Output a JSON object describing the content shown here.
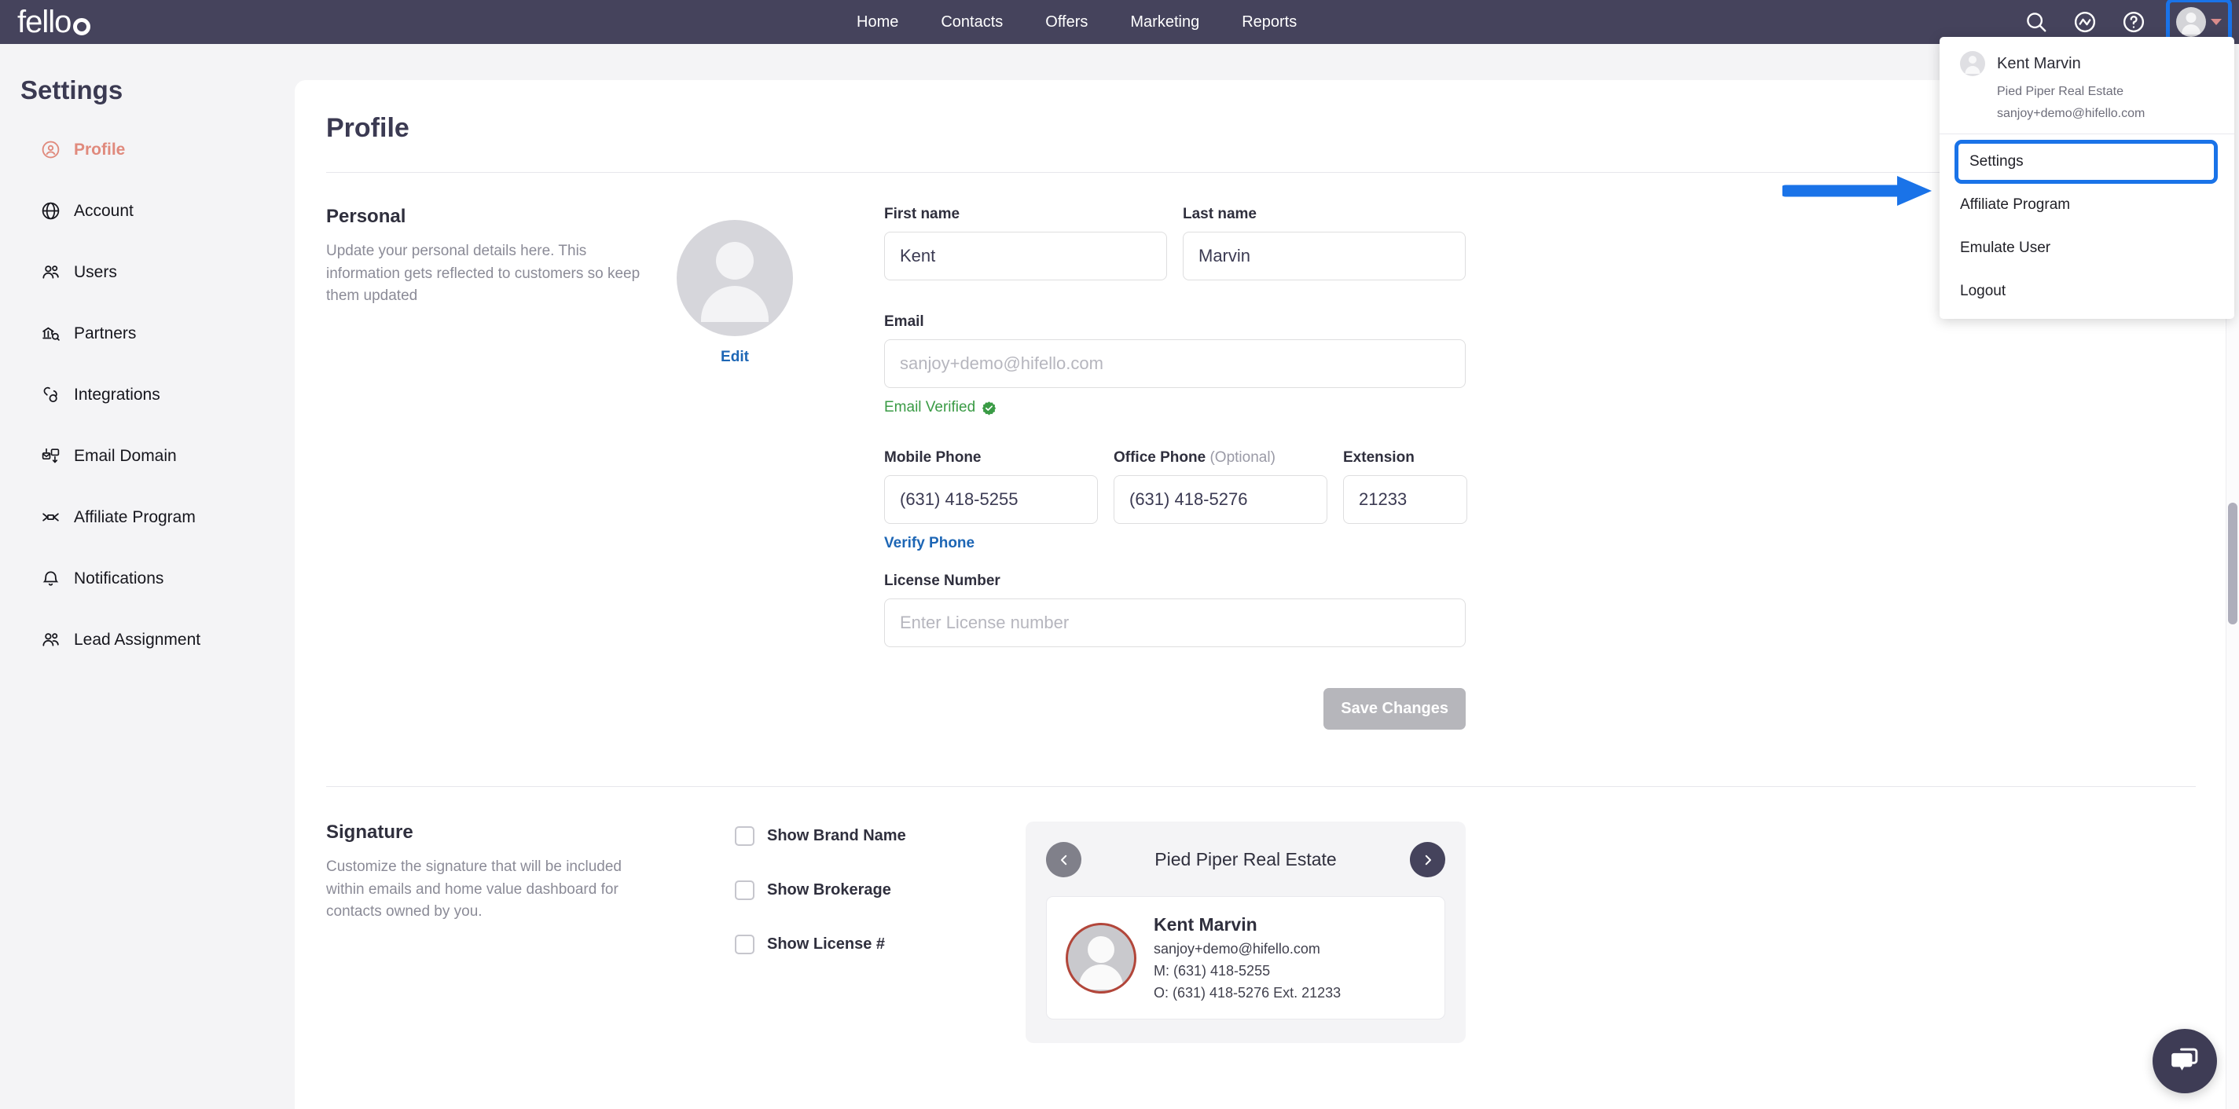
{
  "brand": {
    "logo_text": "fello"
  },
  "topnav": {
    "links": [
      {
        "label": "Home"
      },
      {
        "label": "Contacts"
      },
      {
        "label": "Offers"
      },
      {
        "label": "Marketing"
      },
      {
        "label": "Reports"
      }
    ],
    "icons": [
      "search-icon",
      "activity-icon",
      "help-icon"
    ],
    "accent_highlight": "#1a73e8",
    "bar_color": "#45435c"
  },
  "user_menu": {
    "name": "Kent Marvin",
    "company": "Pied Piper Real Estate",
    "email": "sanjoy+demo@hifello.com",
    "items": [
      {
        "label": "Settings",
        "highlighted": true
      },
      {
        "label": "Affiliate Program",
        "highlighted": false
      },
      {
        "label": "Emulate User",
        "highlighted": false
      },
      {
        "label": "Logout",
        "highlighted": false
      }
    ]
  },
  "sidebar": {
    "title": "Settings",
    "active_color": "#e08a7d",
    "items": [
      {
        "label": "Profile",
        "icon": "user-circle-icon",
        "active": true
      },
      {
        "label": "Account",
        "icon": "globe-icon",
        "active": false
      },
      {
        "label": "Users",
        "icon": "users-icon",
        "active": false
      },
      {
        "label": "Partners",
        "icon": "partners-icon",
        "active": false
      },
      {
        "label": "Integrations",
        "icon": "link-icon",
        "active": false
      },
      {
        "label": "Email Domain",
        "icon": "email-domain-icon",
        "active": false
      },
      {
        "label": "Affiliate Program",
        "icon": "affiliate-icon",
        "active": false
      },
      {
        "label": "Notifications",
        "icon": "bell-icon",
        "active": false
      },
      {
        "label": "Lead Assignment",
        "icon": "users-icon",
        "active": false
      }
    ]
  },
  "page": {
    "title": "Profile"
  },
  "personal": {
    "heading": "Personal",
    "description": "Update your personal details here. This information gets reflected to customers so keep them updated",
    "edit_label": "Edit",
    "fields": {
      "first_name_label": "First name",
      "first_name_value": "Kent",
      "last_name_label": "Last name",
      "last_name_value": "Marvin",
      "email_label": "Email",
      "email_value": "sanjoy+demo@hifello.com",
      "email_verified_text": "Email Verified",
      "mobile_label": "Mobile Phone",
      "mobile_value": "(631) 418-5255",
      "office_label": "Office Phone",
      "office_optional": "(Optional)",
      "office_value": "(631) 418-5276",
      "extension_label": "Extension",
      "extension_value": "21233",
      "verify_phone_label": "Verify Phone",
      "license_label": "License Number",
      "license_placeholder": "Enter License number"
    },
    "save_label": "Save Changes"
  },
  "signature": {
    "heading": "Signature",
    "description": "Customize the signature that will be included within emails and home value dashboard for contacts owned by you.",
    "checkboxes": [
      {
        "label": "Show Brand Name",
        "checked": false
      },
      {
        "label": "Show Brokerage",
        "checked": false
      },
      {
        "label": "Show License #",
        "checked": false
      }
    ],
    "preview": {
      "brand": "Pied Piper Real Estate",
      "name": "Kent Marvin",
      "email": "sanjoy+demo@hifello.com",
      "mobile": "M: (631) 418-5255",
      "office": "O: (631) 418-5276 Ext. 21233"
    }
  },
  "chat": {
    "icon": "chat-bubble-icon"
  }
}
